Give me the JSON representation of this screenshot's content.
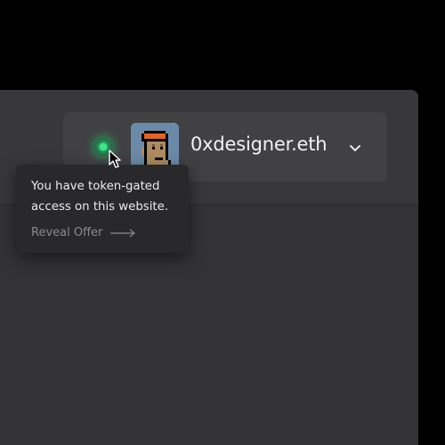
{
  "wallet": {
    "name": "0xdesigner.eth",
    "status": "connected",
    "status_color": "#3ee58a",
    "avatar_icon": "pixel-punk-avatar",
    "dropdown_icon": "chevron-down-icon"
  },
  "tooltip": {
    "message": "You have token-gated access on this website.",
    "link_label": "Reveal Offer",
    "link_icon": "arrow-right-icon"
  },
  "colors": {
    "page_background": "#000000",
    "window_background": "#333335",
    "header_background": "#38383b",
    "pill_background": "#414144",
    "tooltip_background": "#29292b"
  }
}
